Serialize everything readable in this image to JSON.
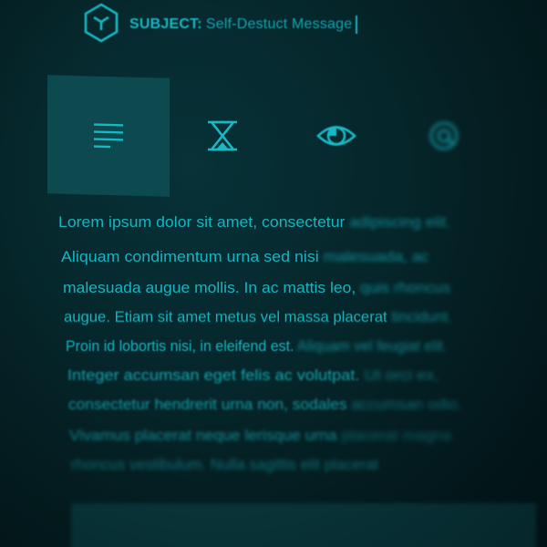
{
  "header": {
    "logo_icon": "cube-icon",
    "subject_label": "SUBJECT:",
    "subject_value": "Self-Destuct Message"
  },
  "tabs": [
    {
      "icon": "text-lines-icon",
      "active": true
    },
    {
      "icon": "hourglass-icon",
      "active": false
    },
    {
      "icon": "eye-icon",
      "active": false
    },
    {
      "icon": "at-sign-icon",
      "active": false
    }
  ],
  "body_lines": [
    {
      "clear": "Lorem ipsum dolor sit amet, consectetur",
      "fade": " adipiscing elit."
    },
    {
      "clear": "Aliquam condimentum urna sed nisi",
      "fade": " malesuada, ac"
    },
    {
      "clear": "malesuada augue mollis. In ac mattis leo,",
      "fade": " quis rhoncus"
    },
    {
      "clear": "augue. Etiam sit amet metus vel massa placerat",
      "fade": " tincidunt."
    },
    {
      "clear": "Proin id lobortis nisi, in eleifend est.",
      "fade": " Aliquam vel feugiat elit."
    },
    {
      "clear": "Integer accumsan eget felis ac volutpat.",
      "fade": " Ut orci ex,"
    },
    {
      "clear": "consectetur hendrerit urna non, sodales",
      "fade": " accumsan odio."
    },
    {
      "clear": "Vivamus placerat neque lerisque urna",
      "fade": " placerat magna"
    },
    {
      "clear": "rhoncus vestibulum. Nulla sagittis elit placerat",
      "fade": ""
    }
  ],
  "colors": {
    "accent": "#18b8c4",
    "background": "#052529",
    "active_tab": "#0c4a4f"
  }
}
